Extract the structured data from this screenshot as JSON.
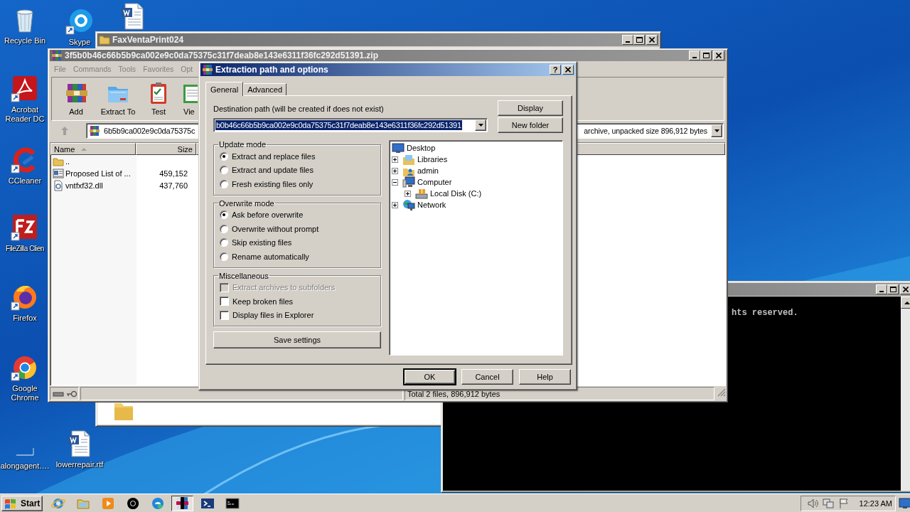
{
  "desktop_icons": [
    {
      "kind": "recycle-bin",
      "label": "Recycle Bin",
      "shortcut": false
    },
    {
      "kind": "skype",
      "label": "Skype",
      "shortcut": true
    },
    {
      "kind": "word-document",
      "shortcut": false
    },
    {
      "kind": "acrobat",
      "label": "Acrobat Reader DC",
      "shortcut": true
    },
    {
      "kind": "ccleaner",
      "label": "CCleaner",
      "shortcut": true
    },
    {
      "kind": "filezilla",
      "label": "FileZilla Clien",
      "shortcut": true
    },
    {
      "kind": "firefox",
      "label": "Firefox",
      "shortcut": true
    },
    {
      "kind": "chrome",
      "label": "Google Chrome",
      "shortcut": true
    },
    {
      "kind": "blank",
      "label": "alongagent….",
      "shortcut": false
    },
    {
      "kind": "word-document",
      "label": "lowerrepair.rtf",
      "shortcut": false
    }
  ],
  "explorer_window": {
    "title": "FaxVentaPrint024",
    "active": false
  },
  "console_window": {
    "active": false,
    "text": "hts reserved."
  },
  "archive_window": {
    "title": "3f5b0b46c66b5b9ca002e9c0da75375c31f7deab8e143e6311f36fc292d51391.zip",
    "active": false,
    "menu": [
      "File",
      "Commands",
      "Tools",
      "Favorites",
      "Opt"
    ],
    "toolbar": [
      {
        "kind": "add",
        "label": "Add"
      },
      {
        "kind": "extract",
        "label": "Extract To"
      },
      {
        "kind": "test",
        "label": "Test"
      },
      {
        "kind": "view",
        "label": "Vie"
      }
    ],
    "address": "6b5b9ca002e9c0da75375c",
    "address_info": "archive, unpacked size 896,912 bytes",
    "columns": [
      "Name",
      "Size"
    ],
    "files": [
      {
        "kind": "folder",
        "name": ".."
      },
      {
        "kind": "document",
        "name": "Proposed List of ...",
        "size": "459,152"
      },
      {
        "kind": "dll",
        "name": "vntfxf32.dll",
        "size": "437,760"
      }
    ],
    "status": "Total 2 files, 896,912 bytes"
  },
  "extraction_dialog": {
    "title": "Extraction path and options",
    "active": true,
    "help_glyph": "?",
    "tabs": [
      {
        "label": "General",
        "selected": true
      },
      {
        "label": "Advanced",
        "selected": false
      }
    ],
    "destination_label": "Destination path (will be created if does not exist)",
    "destination_value": "b0b46c66b5b9ca002e9c0da75375c31f7deab8e143e6311f36fc292d51391",
    "side_buttons": [
      "Display",
      "New folder"
    ],
    "update_mode": {
      "title": "Update mode",
      "options": [
        {
          "label": "Extract and replace files",
          "selected": true
        },
        {
          "label": "Extract and update files",
          "selected": false
        },
        {
          "label": "Fresh existing files only",
          "selected": false
        }
      ]
    },
    "overwrite_mode": {
      "title": "Overwrite mode",
      "options": [
        {
          "label": "Ask before overwrite",
          "selected": true
        },
        {
          "label": "Overwrite without prompt",
          "selected": false
        },
        {
          "label": "Skip existing files",
          "selected": false
        },
        {
          "label": "Rename automatically",
          "selected": false
        }
      ]
    },
    "miscellaneous": {
      "title": "Miscellaneous",
      "options": [
        {
          "label": "Extract archives to subfolders",
          "checked": false,
          "disabled": true
        },
        {
          "label": "Keep broken files",
          "checked": false,
          "disabled": false
        },
        {
          "label": "Display files in Explorer",
          "checked": false,
          "disabled": false
        }
      ]
    },
    "save_button": "Save settings",
    "folder_tree": [
      {
        "kind": "desktop",
        "label": "Desktop",
        "children": [
          {
            "kind": "libraries",
            "label": "Libraries",
            "expanded": false
          },
          {
            "kind": "user",
            "label": "admin",
            "expanded": false
          },
          {
            "kind": "computer",
            "label": "Computer",
            "expanded": true,
            "children": [
              {
                "kind": "disk",
                "label": "Local Disk (C:)",
                "expanded": false
              }
            ]
          },
          {
            "kind": "network",
            "label": "Network",
            "expanded": false
          }
        ]
      }
    ],
    "buttons": [
      {
        "label": "OK",
        "default": true
      },
      {
        "label": "Cancel",
        "default": false
      },
      {
        "label": "Help",
        "default": false
      }
    ]
  },
  "taskbar": {
    "start": "Start",
    "buttons": [
      {
        "kind": "ie",
        "selected": false
      },
      {
        "kind": "explorer",
        "selected": false
      },
      {
        "kind": "media",
        "selected": false
      },
      {
        "kind": "chrome",
        "selected": false
      },
      {
        "kind": "edge",
        "selected": false
      },
      {
        "kind": "archiver",
        "selected": true
      },
      {
        "kind": "powershell",
        "selected": false
      },
      {
        "kind": "console",
        "selected": false
      }
    ],
    "clock": "12:23 AM"
  }
}
